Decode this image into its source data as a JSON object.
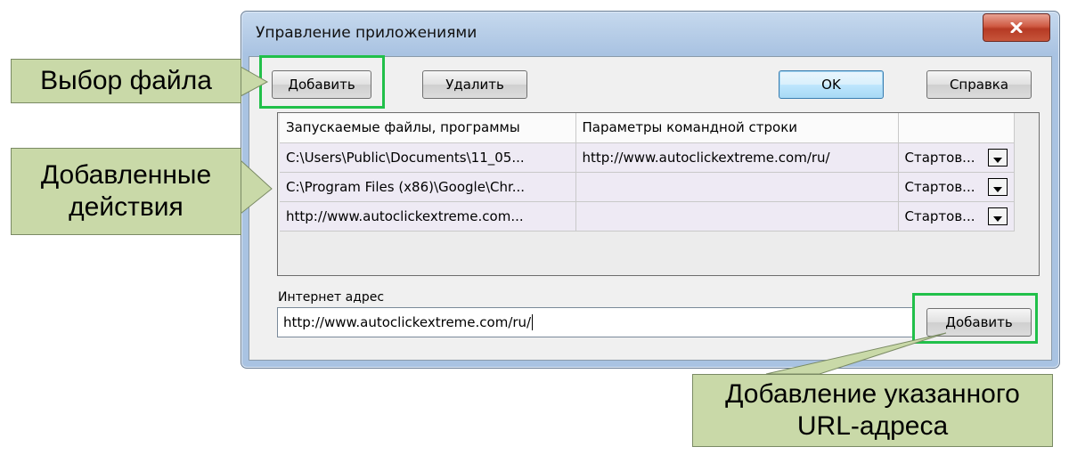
{
  "window": {
    "title": "Управление приложениями"
  },
  "toolbar": {
    "add_label": "Добавить",
    "delete_label": "Удалить",
    "ok_label": "OK",
    "help_label": "Справка"
  },
  "grid": {
    "columns": [
      "Запускаемые файлы, программы",
      "Параметры командной строки",
      ""
    ],
    "rows": [
      {
        "file": "C:\\Users\\Public\\Documents\\11_05...",
        "params": "http://www.autoclickextreme.com/ru/",
        "mode": "Стартов..."
      },
      {
        "file": "C:\\Program Files (x86)\\Google\\Chr...",
        "params": "",
        "mode": "Стартов..."
      },
      {
        "file": "http://www.autoclickextreme.com...",
        "params": "",
        "mode": "Стартов..."
      }
    ]
  },
  "url": {
    "label": "Интернет адрес",
    "value": "http://www.autoclickextreme.com/ru/",
    "add_label": "Добавить"
  },
  "callouts": {
    "file_select": "Выбор файла",
    "added_actions_line1": "Добавленные",
    "added_actions_line2": "действия",
    "add_url_line1": "Добавление указанного",
    "add_url_line2": "URL-адреса"
  },
  "colors": {
    "highlight": "#21c04a",
    "callout_bg": "#c9d9a8",
    "close_button": "#c7553b"
  }
}
